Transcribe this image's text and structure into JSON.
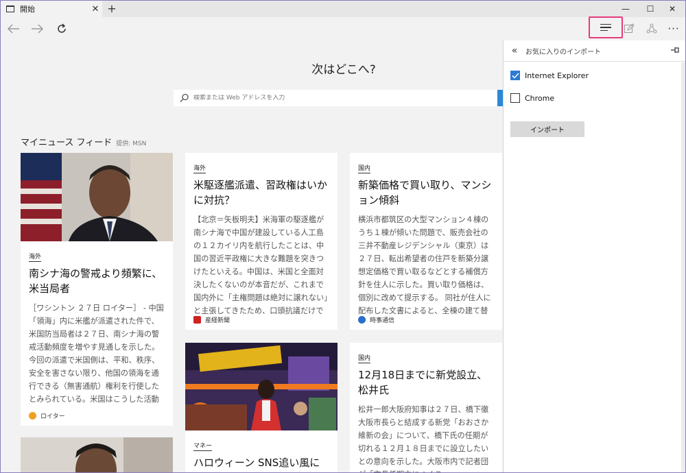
{
  "tab": {
    "title": "開始",
    "close": "✕",
    "new_tab": "+"
  },
  "window_controls": {
    "minimize": "—",
    "maximize": "☐",
    "close": "✕"
  },
  "toolbar": {
    "more": "···"
  },
  "start": {
    "question": "次はどこへ?",
    "search_placeholder": "検索または Web アドレスを入力"
  },
  "feed": {
    "title": "マイニュース フィード",
    "provider": "提供: MSN",
    "cards": [
      {
        "category": "海外",
        "title": "南シナ海の警戒より頻繁に、米当局者",
        "body": "［ワシントン ２７日 ロイター］ - 中国「領海」内に米艦が派遣された件で、米国防当局者は２７日、南シナ海の警戒活動頻度を増やす見通しを示した。今回の派遣で米国側は、平和、秩序、安全を害さない限り、他国の領海を通行できる（無害通航）権利を行使したとみられている。米国はこうした活動を定例化する考え…",
        "source": "ロイター"
      },
      {
        "category": "海外",
        "title": "米駆逐艦派遣、習政権はいかに対抗？",
        "body": "【北京＝矢板明夫】米海軍の駆逐艦が南シナ海で中国が建設している人工島の１２カイリ内を航行したことは、中国の習近平政権に大きな難題を突きつけたといえる。中国は、米国と全面対決したくないのが本音だが、これまで国内外に「主権問題は絶対に譲れない」と主張してきたため、口頭抗議だけで済ますのは難し…",
        "source": "産経新聞"
      },
      {
        "category": "国内",
        "title": "新築価格で買い取り、マンション傾斜",
        "body": "横浜市都筑区の大型マンション４棟のうち１棟が傾いた問題で、販売会社の三井不動産レジデンシャル（東京）は２７日、転出希望者の住戸を新築分譲想定価格で買い取るなどとする補償方針を住人に示した。買い取り価格は、個別に改めて提示する。 同社が住人に配布した文書によると、全棟の建て替えを基本とし、…",
        "source": "時事通信"
      },
      {
        "category": "マネー",
        "title": "ハロウィーン SNS追い風に市場急成長"
      },
      {
        "category": "国内",
        "title": "12月18日までに新党設立、松井氏",
        "body": "松井一郎大阪府知事は２７日、橋下徹大阪市長らと結成する新党「おおさか維新の会」について、橋下氏の任期が切れる１２月１８日までに設立したいとの意向を示した。大阪市内で記者団が「市長任期中につくり"
      }
    ]
  },
  "panel": {
    "back": "«",
    "title": "お気に入りのインポート",
    "options": [
      {
        "label": "Internet Explorer",
        "checked": true
      },
      {
        "label": "Chrome",
        "checked": false
      }
    ],
    "import_label": "インポート"
  },
  "colors": {
    "accent": "#2b7bd3",
    "highlight_border": "#e8397a"
  }
}
